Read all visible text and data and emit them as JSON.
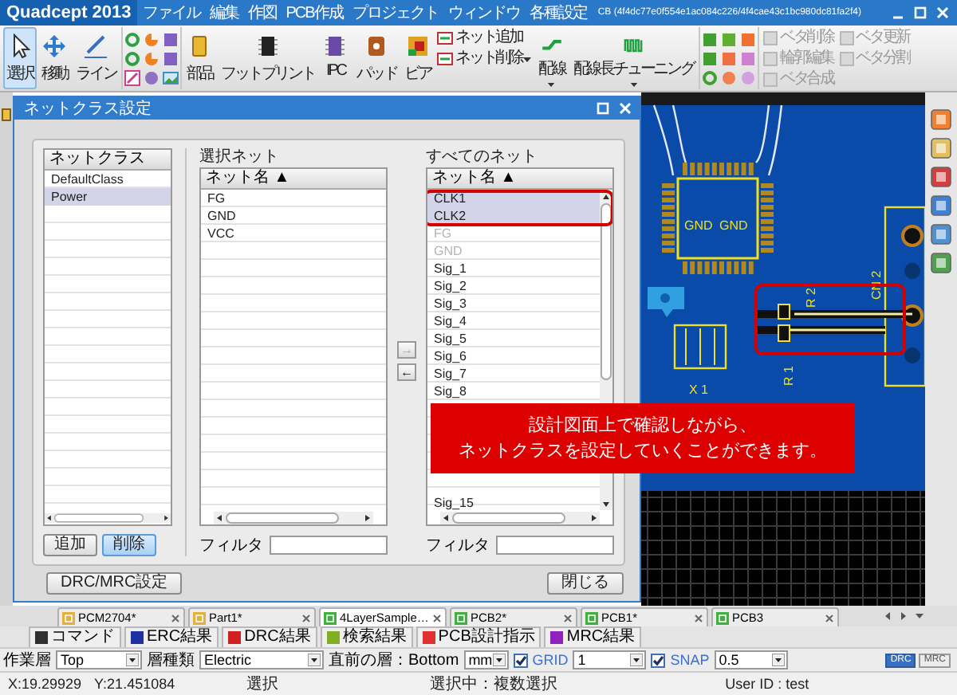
{
  "window": {
    "logo": "Quadcept 2013",
    "menu": [
      "ファイル",
      "編集",
      "作図",
      "PCB作成",
      "プロジェクト",
      "ウィンドウ",
      "各種設定"
    ],
    "title": "CB (4f4dc77e0f554e1ac084c226/4f4cae43c1bc980dc81fa2f4)"
  },
  "ribbon": [
    {
      "kind": "large",
      "label": "選択",
      "selected": true,
      "dropdown": false
    },
    {
      "kind": "large",
      "label": "移動",
      "selected": false,
      "dropdown": false
    },
    {
      "kind": "large",
      "label": "ライン",
      "selected": false,
      "dropdown": false
    },
    {
      "kind": "grid"
    },
    {
      "kind": "large",
      "label": "部品",
      "selected": false,
      "dropdown": false
    },
    {
      "kind": "large",
      "label": "フットプリント",
      "selected": false,
      "dropdown": false
    },
    {
      "kind": "large",
      "label": "IPC",
      "selected": false,
      "dropdown": false
    },
    {
      "kind": "large",
      "label": "パッド",
      "selected": false,
      "dropdown": false
    },
    {
      "kind": "large",
      "label": "ビア",
      "selected": false,
      "dropdown": false
    },
    {
      "kind": "stack",
      "items": [
        {
          "label": "ネット追加",
          "disabled": false,
          "dropdown": false
        },
        {
          "label": "ネット削除",
          "disabled": false,
          "dropdown": true
        }
      ]
    },
    {
      "kind": "large",
      "label": "配線",
      "selected": false,
      "dropdown": true
    },
    {
      "kind": "large",
      "label": "配線長チューニング",
      "selected": false,
      "dropdown": true
    },
    {
      "kind": "grid"
    },
    {
      "kind": "stack",
      "items": [
        {
          "label": "ベタ削除",
          "disabled": true,
          "dropdown": false
        },
        {
          "label": "輪郭編集",
          "disabled": true,
          "dropdown": false
        },
        {
          "label": "ベタ合成",
          "disabled": true,
          "dropdown": false
        }
      ]
    },
    {
      "kind": "stack",
      "items": [
        {
          "label": "ベタ更新",
          "disabled": true,
          "dropdown": false
        },
        {
          "label": "ベタ分割",
          "disabled": true,
          "dropdown": false
        }
      ]
    }
  ],
  "pcb_labels": [
    "GND",
    "GND",
    "X 1",
    "CN 2",
    "R 1",
    "R 2"
  ],
  "dialog": {
    "title": "ネットクラス設定",
    "classes": {
      "header": "ネットクラス",
      "items": [
        {
          "name": "DefaultClass",
          "selected": false
        },
        {
          "name": "Power",
          "selected": true
        }
      ],
      "buttons": [
        {
          "label": "追加",
          "highlighted": false
        },
        {
          "label": "削除",
          "highlighted": true
        }
      ]
    },
    "selected_nets": {
      "label": "選択ネット",
      "header": "ネット名 ▲",
      "items": [
        "FG",
        "GND",
        "VCC"
      ],
      "filter_label": "フィルタ"
    },
    "move_buttons": [
      {
        "symbol": "→",
        "disabled": true
      },
      {
        "symbol": "←",
        "disabled": false
      }
    ],
    "all_nets": {
      "label": "すべてのネット",
      "header": "ネット名 ▲",
      "items_top": [
        {
          "name": "CLK1",
          "selected": true,
          "disabled": false
        },
        {
          "name": "CLK2",
          "selected": true,
          "disabled": false
        },
        {
          "name": "FG",
          "selected": false,
          "disabled": true
        },
        {
          "name": "GND",
          "selected": false,
          "disabled": true
        },
        {
          "name": "Sig_1",
          "selected": false,
          "disabled": false
        },
        {
          "name": "Sig_2",
          "selected": false,
          "disabled": false
        },
        {
          "name": "Sig_3",
          "selected": false,
          "disabled": false
        },
        {
          "name": "Sig_4",
          "selected": false,
          "disabled": false
        },
        {
          "name": "Sig_5",
          "selected": false,
          "disabled": false
        },
        {
          "name": "Sig_6",
          "selected": false,
          "disabled": false
        },
        {
          "name": "Sig_7",
          "selected": false,
          "disabled": false
        },
        {
          "name": "Sig_8",
          "selected": false,
          "disabled": false
        }
      ],
      "items_bottom": [
        {
          "name": "Sig_15",
          "selected": false,
          "disabled": false
        }
      ],
      "filter_label": "フィルタ"
    },
    "footer": {
      "left": "DRC/MRC設定",
      "right": "閉じる"
    }
  },
  "callout": {
    "lines": [
      "設計図面上で確認しながら、",
      "ネットクラスを設定していくことができます。"
    ]
  },
  "doc_tabs": [
    {
      "label": "PCM2704*",
      "selected": false,
      "color": "#e0b040"
    },
    {
      "label": "Part1*",
      "selected": false,
      "color": "#e0b040"
    },
    {
      "label": "4LayerSample…",
      "selected": true,
      "color": "#40b040"
    },
    {
      "label": "PCB2*",
      "selected": false,
      "color": "#40b040"
    },
    {
      "label": "PCB1*",
      "selected": false,
      "color": "#40b040"
    },
    {
      "label": "PCB3",
      "selected": false,
      "color": "#40b040"
    }
  ],
  "panel_tabs": [
    {
      "label": "コマンド",
      "color": "#303030"
    },
    {
      "label": "ERC結果",
      "color": "#2030a0"
    },
    {
      "label": "DRC結果",
      "color": "#d02020"
    },
    {
      "label": "検索結果",
      "color": "#80b020"
    },
    {
      "label": "PCB設計指示",
      "color": "#e03030"
    },
    {
      "label": "MRC結果",
      "color": "#9020c0"
    }
  ],
  "toolbar": {
    "layer_label": "作業層",
    "layer": "Top",
    "type_label": "層種類",
    "type": "Electric",
    "previous_layer": "直前の層：Bottom",
    "unit": "mm",
    "grid": {
      "label": "GRID",
      "checked": true,
      "value": "1"
    },
    "snap": {
      "label": "SNAP",
      "checked": true,
      "value": "0.5"
    },
    "modes": [
      {
        "label": "DRC",
        "on": true
      },
      {
        "label": "MRC",
        "on": false
      }
    ]
  },
  "status_bar": {
    "x": "X:19.29929",
    "y": "Y:21.451084",
    "mode": "選択",
    "selection": "選択中：複数選択",
    "user": "User ID : test"
  }
}
